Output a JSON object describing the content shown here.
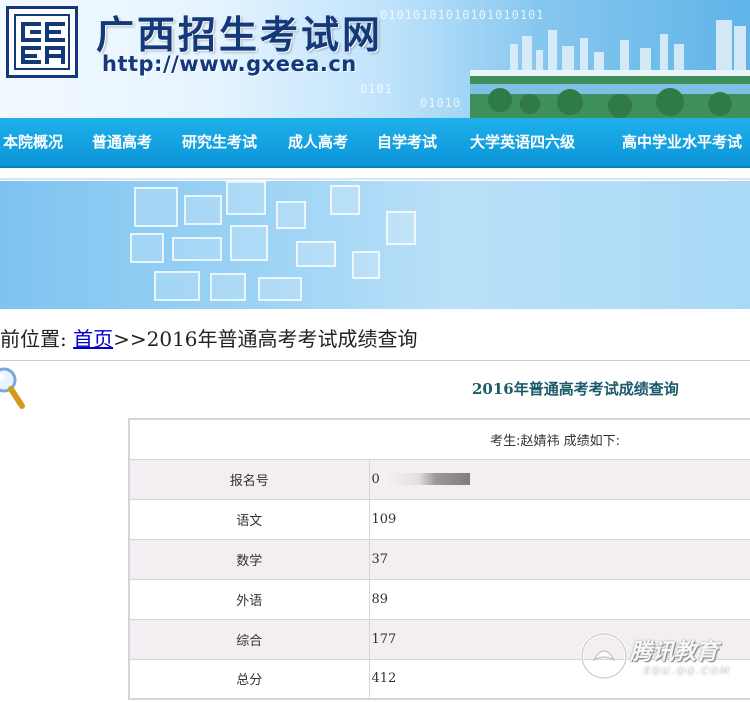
{
  "header": {
    "site_title": "广西招生考试网",
    "site_url": "http://www.gxeea.cn",
    "logo_icon": "gxeea-logo-icon"
  },
  "nav": {
    "items": [
      {
        "label": "本院概况"
      },
      {
        "label": "普通高考"
      },
      {
        "label": "研究生考试"
      },
      {
        "label": "成人高考"
      },
      {
        "label": "自学考试"
      },
      {
        "label": "大学英语四六级"
      },
      {
        "label": "高中学业水平考试"
      }
    ]
  },
  "breadcrumb": {
    "prefix": "前位置:",
    "home_link": "首页",
    "current": ">>2016年普通高考考试成绩查询"
  },
  "result": {
    "icon": "magnifier-icon",
    "title": "2016年普通高考考试成绩查询",
    "header_text": "考生:赵婧祎 成绩如下:",
    "rows": [
      {
        "label": "报名号",
        "value": "0"
      },
      {
        "label": "语文",
        "value": "109"
      },
      {
        "label": "数学",
        "value": "37"
      },
      {
        "label": "外语",
        "value": "89"
      },
      {
        "label": "综合",
        "value": "177"
      },
      {
        "label": "总分",
        "value": "412"
      }
    ]
  },
  "watermark": {
    "text": "腾讯教育",
    "sub": "EDU.QQ.COM"
  },
  "colors": {
    "nav_bg": "#0c95d9",
    "title_blue": "#14397a",
    "row_shade": "#f3eef2",
    "link": "#0000cc"
  }
}
